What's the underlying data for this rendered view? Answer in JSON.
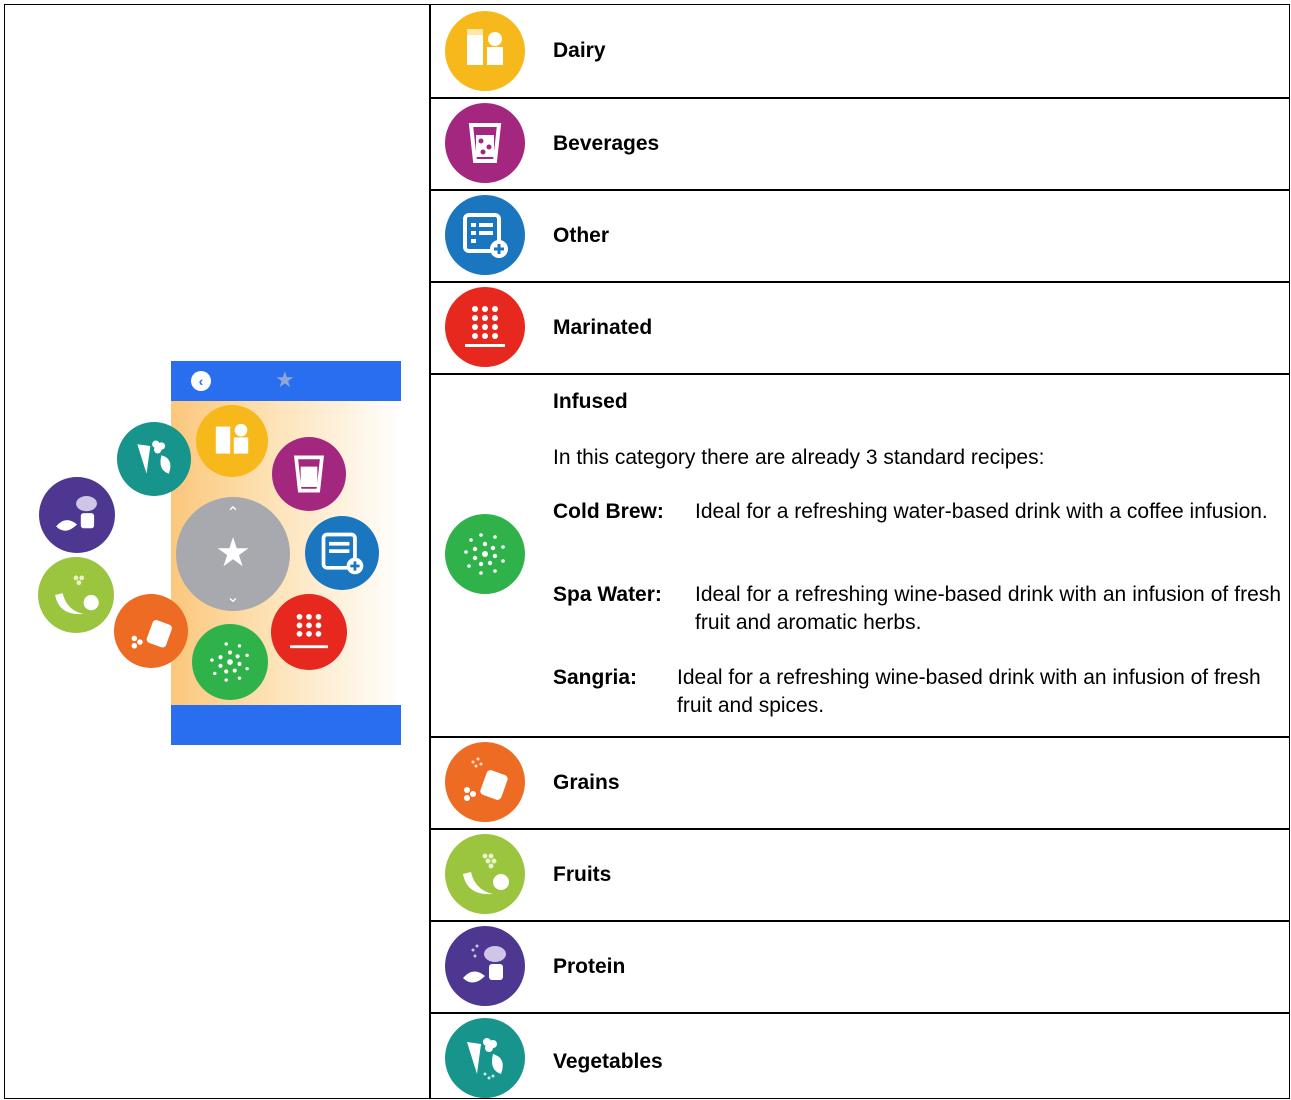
{
  "colors": {
    "dairy": "#f7b81b",
    "beverages": "#a3267f",
    "other": "#1a76bf",
    "marinated": "#e6281e",
    "infused": "#2fb24a",
    "grains": "#ee6b23",
    "fruits": "#9bc43f",
    "protein": "#4d3791",
    "vegetables": "#17948b",
    "device_bar": "#2a6ef0"
  },
  "categories": [
    {
      "label": "Dairy",
      "icon": "dairy-icon"
    },
    {
      "label": "Beverages",
      "icon": "beverages-icon"
    },
    {
      "label": "Other",
      "icon": "other-icon"
    },
    {
      "label": "Marinated",
      "icon": "marinated-icon"
    },
    {
      "label": "Infused",
      "icon": "infused-icon"
    },
    {
      "label": "Grains",
      "icon": "grains-icon"
    },
    {
      "label": "Fruits",
      "icon": "fruits-icon"
    },
    {
      "label": "Protein",
      "icon": "protein-icon"
    },
    {
      "label": "Vegetables",
      "icon": "vegetables-icon"
    }
  ],
  "infused": {
    "intro": "In this category there are already 3 standard recipes:",
    "recipes": [
      {
        "name": "Cold Brew:",
        "desc": "Ideal for a refreshing water-based drink with a coffee infusion."
      },
      {
        "name": "Spa Water:",
        "desc": "Ideal for a refreshing wine-based drink with an infusion of fresh fruit and aromatic herbs."
      },
      {
        "name": "Sangria:",
        "desc": "Ideal for a refreshing wine-based drink with an infusion of fresh fruit and spices."
      }
    ]
  },
  "device": {
    "back_glyph": "‹",
    "star_glyph": "★",
    "up_glyph": "⌃",
    "down_glyph": "⌄"
  }
}
